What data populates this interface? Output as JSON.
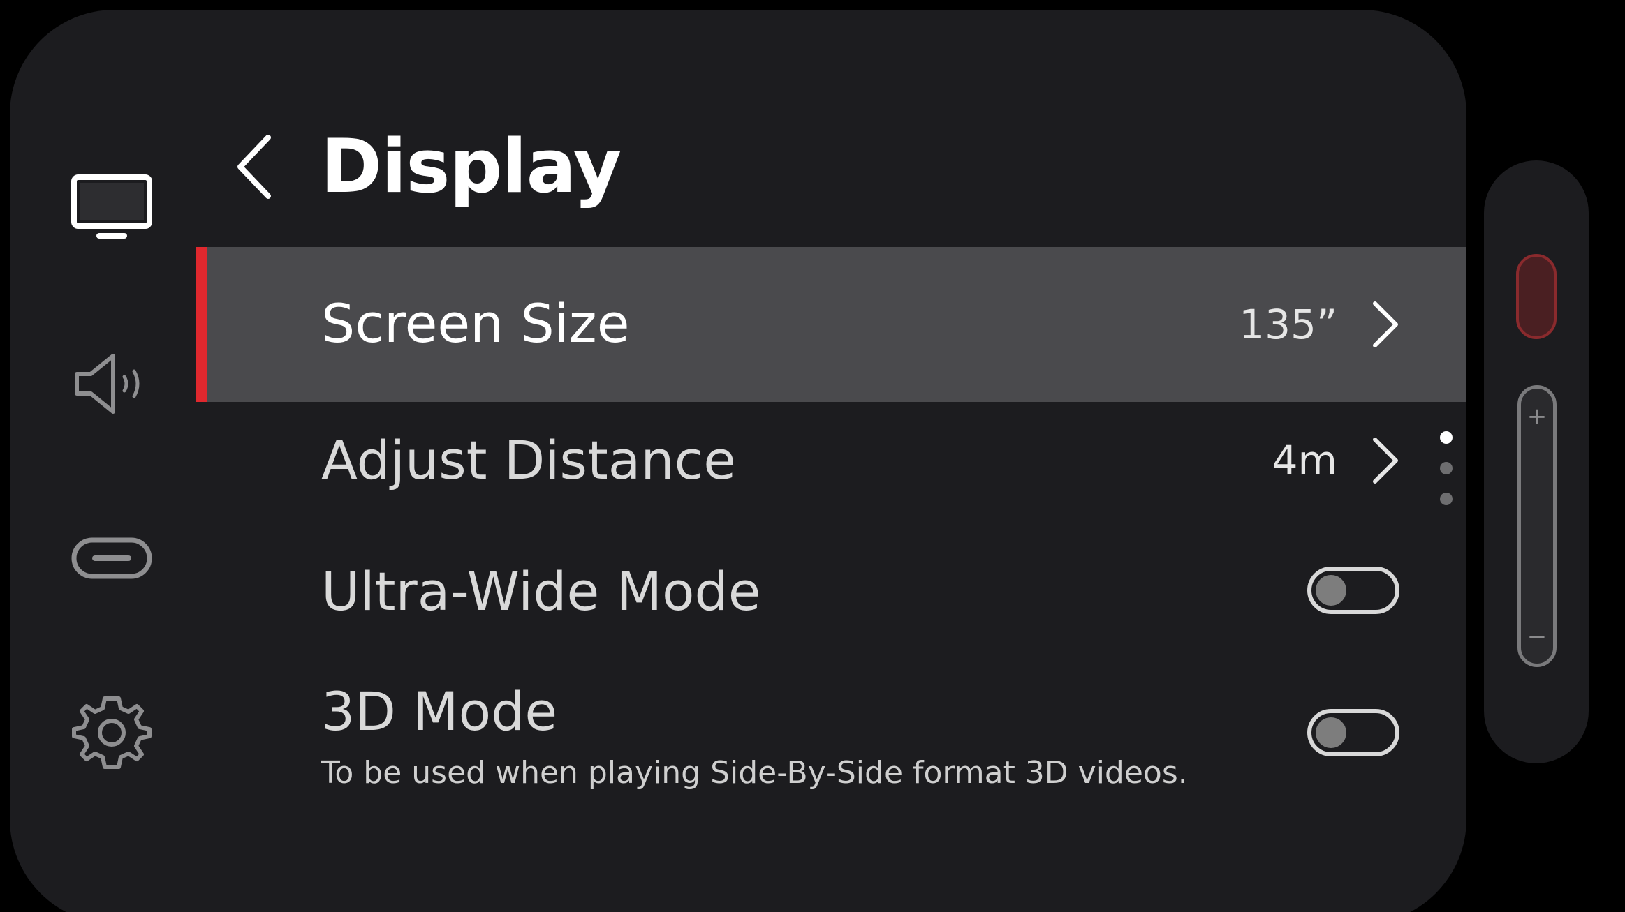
{
  "header": {
    "title": "Display"
  },
  "sidebar": {
    "items": [
      {
        "name": "display",
        "icon": "monitor-icon"
      },
      {
        "name": "sound",
        "icon": "speaker-icon"
      },
      {
        "name": "connection",
        "icon": "usb-c-icon"
      },
      {
        "name": "settings",
        "icon": "gear-icon"
      }
    ]
  },
  "menu": {
    "rows": [
      {
        "label": "Screen Size",
        "value": "135”"
      },
      {
        "label": "Adjust Distance",
        "value": "4m"
      },
      {
        "label": "Ultra-Wide Mode",
        "enabled": false
      },
      {
        "label": "3D Mode",
        "description": "To be used when playing Side-By-Side format 3D videos.",
        "enabled": false
      }
    ]
  },
  "controller": {
    "plus": "+",
    "minus": "−"
  },
  "colors": {
    "accent": "#e0282e",
    "panel": "#1c1c1f",
    "selected_row": "#4a4a4d"
  }
}
